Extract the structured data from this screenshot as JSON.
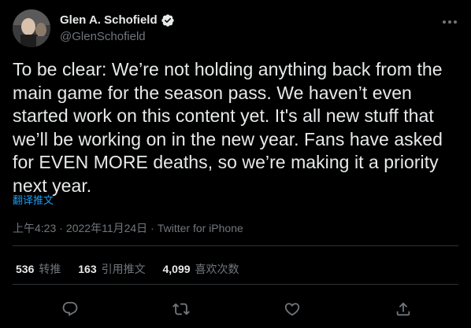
{
  "author": {
    "display_name": "Glen A. Schofield",
    "handle": "@GlenSchofield",
    "verified": true
  },
  "tweet": {
    "text": "To be clear: We’re not holding anything back from the\nmain game for the season pass. We haven’t even\nstarted work on this content yet. It's all new stuff that\nwe’ll be working on in the new year. Fans have asked\nfor EVEN MORE deaths, so we’re making it a priority\nnext year.",
    "translate_label": "翻译推文",
    "time": "上午4:23",
    "date": "2022年11月24日",
    "separator": "·",
    "source": "Twitter for iPhone"
  },
  "stats": {
    "retweets": {
      "count": "536",
      "label": "转推"
    },
    "quotes": {
      "count": "163",
      "label": "引用推文"
    },
    "likes": {
      "count": "4,099",
      "label": "喜欢次数"
    }
  },
  "icons": {
    "more": "more-icon",
    "reply": "reply-icon",
    "retweet": "retweet-icon",
    "like": "like-icon",
    "share": "share-icon",
    "verified": "verified-badge-icon"
  },
  "colors": {
    "background": "#000000",
    "text": "#e7e9ea",
    "secondary": "#71767b",
    "accent": "#1d9bf0",
    "divider": "#2f3336"
  }
}
